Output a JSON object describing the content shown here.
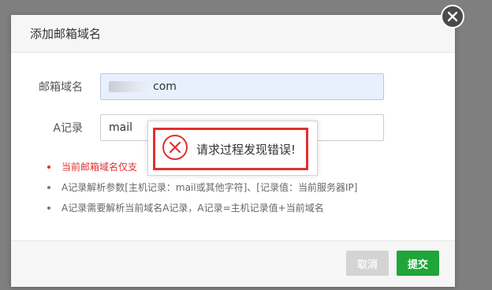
{
  "dialog": {
    "title": "添加邮箱域名"
  },
  "form": {
    "domain_label": "邮箱域名",
    "domain_value": "com",
    "a_record_label": "A记录",
    "a_record_value": "mail"
  },
  "notes": [
    "当前邮箱域名仅支",
    "A记录解析参数[主机记录：mail或其他字符]、[记录值：当前服务器IP]",
    "A记录需要解析当前域名A记录，A记录=主机记录值+当前域名"
  ],
  "footer": {
    "cancel_label": "取消",
    "submit_label": "提交"
  },
  "error": {
    "message": "请求过程发现错误!",
    "icon": "error-x-circle-icon"
  },
  "colors": {
    "accent_green": "#20a53a",
    "error_red": "#e0312f"
  }
}
